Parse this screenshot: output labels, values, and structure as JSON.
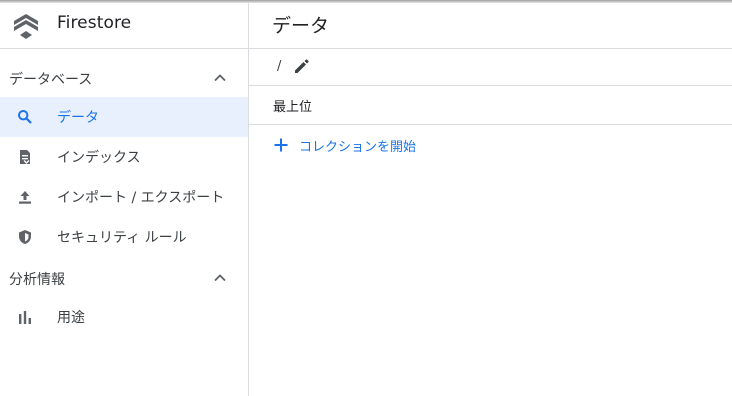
{
  "app": {
    "name": "Firestore"
  },
  "colors": {
    "accent": "#1a73e8",
    "active_bg": "#e8f0fe",
    "icon": "#5f6368",
    "divider": "#dadce0"
  },
  "sidebar": {
    "sections": [
      {
        "label": "データベース",
        "items": [
          {
            "label": "データ",
            "icon": "search-icon",
            "active": true
          },
          {
            "label": "インデックス",
            "icon": "index-icon",
            "active": false
          },
          {
            "label": "インポート / エクスポート",
            "icon": "upload-icon",
            "active": false
          },
          {
            "label": "セキュリティ ルール",
            "icon": "shield-icon",
            "active": false
          }
        ]
      },
      {
        "label": "分析情報",
        "items": [
          {
            "label": "用途",
            "icon": "bar-chart-icon",
            "active": false
          }
        ]
      }
    ]
  },
  "main": {
    "title": "データ",
    "path": "/",
    "root_label": "最上位",
    "add_collection_label": "コレクションを開始"
  }
}
